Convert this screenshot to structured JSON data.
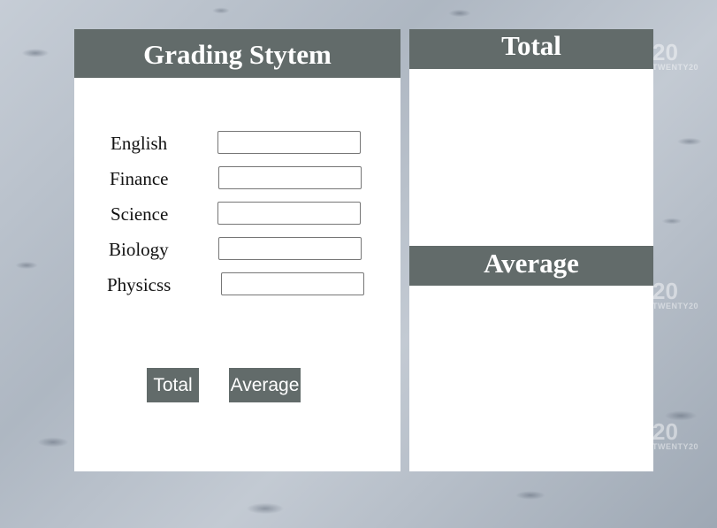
{
  "form": {
    "title": "Grading Stytem",
    "subjects": [
      {
        "label": "English",
        "value": ""
      },
      {
        "label": "Finance",
        "value": ""
      },
      {
        "label": "Science",
        "value": ""
      },
      {
        "label": "Biology",
        "value": ""
      },
      {
        "label": "Physicss",
        "value": ""
      }
    ],
    "buttons": {
      "total_label": "Total",
      "average_label": "Average"
    }
  },
  "results": {
    "total_title": "Total",
    "total_value": "",
    "average_title": "Average",
    "average_value": ""
  },
  "background": {
    "watermark_mark": "20",
    "watermark_text": "TWENTY20"
  },
  "colors": {
    "header_bg": "#626b6a",
    "header_text": "#ffffff",
    "card_bg": "#ffffff"
  }
}
